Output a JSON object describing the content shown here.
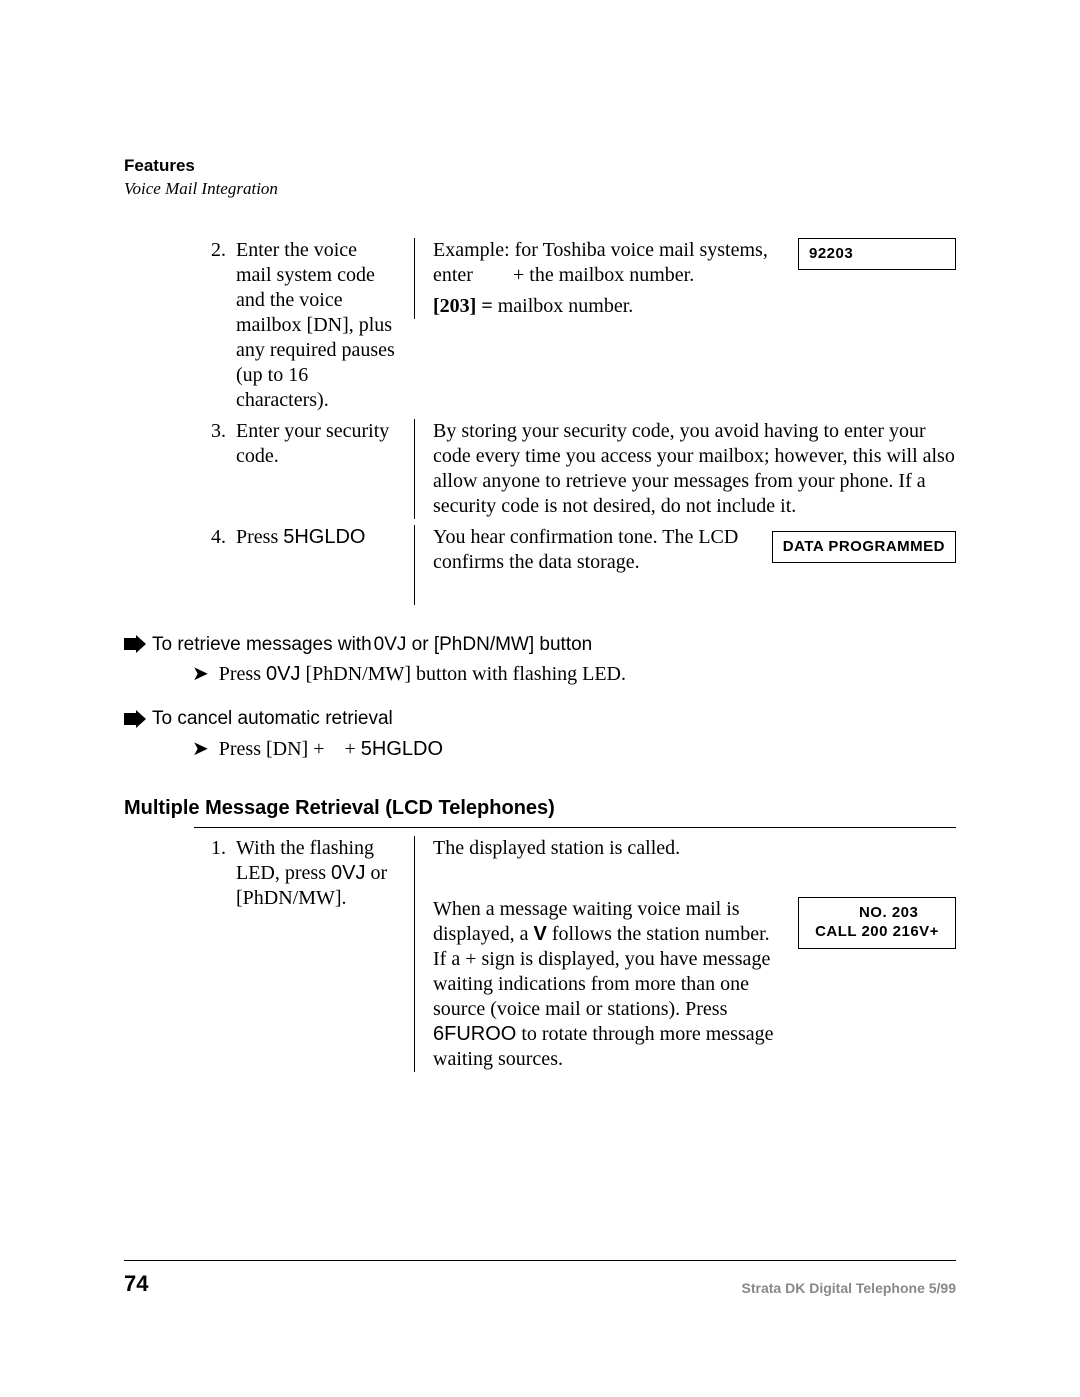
{
  "header": {
    "title": "Features",
    "subtitle": "Voice Mail Integration"
  },
  "steps_a": [
    {
      "num": "2.",
      "text": "Enter the voice mail system code and the voice mailbox [DN], plus any required pauses (up to 16 characters).",
      "expl_top_left": "Example: for Toshiba voice mail systems, enter ",
      "expl_top_left2": " + the mailbox number.",
      "expl_bottom_bold": "[203] =",
      "expl_bottom_rest": " mailbox number.",
      "lcd": "92203"
    },
    {
      "num": "3.",
      "text": "Enter your security code.",
      "expl": "By storing your security code, you avoid having to enter your code every time you access your mailbox; however, this will also allow anyone to retrieve your messages from your phone. If a security code is not desired, do not include it."
    },
    {
      "num": "4.",
      "text_a": "Press ",
      "text_b": "5HGLDO",
      "expl_left": "You hear confirmation tone. The LCD confirms the data storage.",
      "lcd": "DATA PROGRAMMED"
    }
  ],
  "arrow1": {
    "lead": "To retrieve messages with",
    "mid": "0VJ",
    "tail": " or [PhDN/MW] button",
    "sub_a": "Press ",
    "sub_b": "0VJ",
    "sub_c": " [PhDN/MW] button with flashing LED."
  },
  "arrow2": {
    "lead": "To cancel automatic retrieval",
    "sub_a": "Press [DN] + ",
    "sub_b": "   + ",
    "sub_c": "5HGLDO"
  },
  "section2": {
    "title": "Multiple Message Retrieval (LCD Telephones)",
    "step": {
      "num": "1.",
      "text_a": "With the flashing LED, press ",
      "text_b": "0VJ",
      "text_c": " or [PhDN/MW].",
      "expl1": "The displayed station is called.",
      "expl2_a": "When a message waiting voice mail is displayed, a ",
      "expl2_b": "V",
      "expl2_c": " follows the station number. If a + sign is displayed, you have message waiting indications from more than one source (voice mail or stations). Press ",
      "expl2_d": "6FUROO",
      "expl2_e": "to rotate through more message waiting sources.",
      "lcd": "     NO. 203\nCALL 200 216V+"
    }
  },
  "footer": {
    "page": "74",
    "right": "Strata DK Digital Telephone   5/99"
  }
}
